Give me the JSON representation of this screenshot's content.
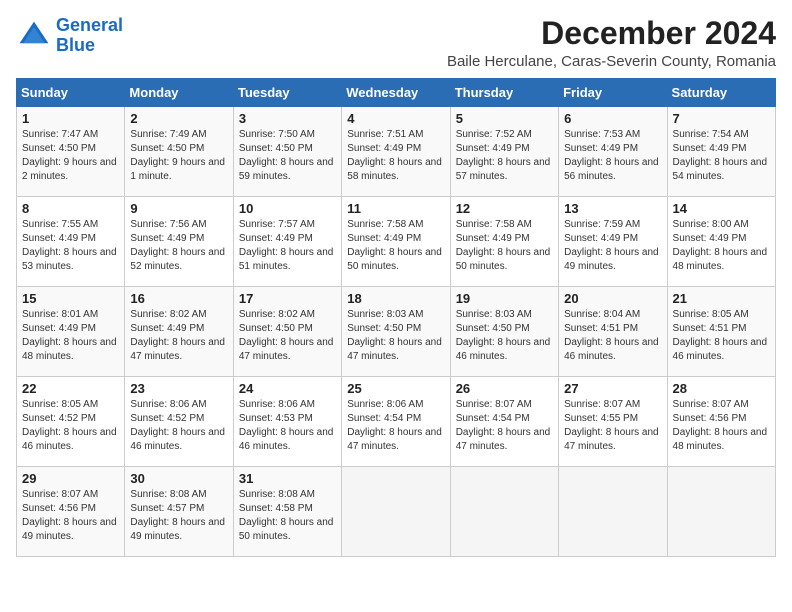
{
  "logo": {
    "line1": "General",
    "line2": "Blue"
  },
  "title": "December 2024",
  "subtitle": "Baile Herculane, Caras-Severin County, Romania",
  "weekdays": [
    "Sunday",
    "Monday",
    "Tuesday",
    "Wednesday",
    "Thursday",
    "Friday",
    "Saturday"
  ],
  "weeks": [
    [
      {
        "day": 1,
        "sunrise": "7:47 AM",
        "sunset": "4:50 PM",
        "daylight": "9 hours and 2 minutes."
      },
      {
        "day": 2,
        "sunrise": "7:49 AM",
        "sunset": "4:50 PM",
        "daylight": "9 hours and 1 minute."
      },
      {
        "day": 3,
        "sunrise": "7:50 AM",
        "sunset": "4:50 PM",
        "daylight": "8 hours and 59 minutes."
      },
      {
        "day": 4,
        "sunrise": "7:51 AM",
        "sunset": "4:49 PM",
        "daylight": "8 hours and 58 minutes."
      },
      {
        "day": 5,
        "sunrise": "7:52 AM",
        "sunset": "4:49 PM",
        "daylight": "8 hours and 57 minutes."
      },
      {
        "day": 6,
        "sunrise": "7:53 AM",
        "sunset": "4:49 PM",
        "daylight": "8 hours and 56 minutes."
      },
      {
        "day": 7,
        "sunrise": "7:54 AM",
        "sunset": "4:49 PM",
        "daylight": "8 hours and 54 minutes."
      }
    ],
    [
      {
        "day": 8,
        "sunrise": "7:55 AM",
        "sunset": "4:49 PM",
        "daylight": "8 hours and 53 minutes."
      },
      {
        "day": 9,
        "sunrise": "7:56 AM",
        "sunset": "4:49 PM",
        "daylight": "8 hours and 52 minutes."
      },
      {
        "day": 10,
        "sunrise": "7:57 AM",
        "sunset": "4:49 PM",
        "daylight": "8 hours and 51 minutes."
      },
      {
        "day": 11,
        "sunrise": "7:58 AM",
        "sunset": "4:49 PM",
        "daylight": "8 hours and 50 minutes."
      },
      {
        "day": 12,
        "sunrise": "7:58 AM",
        "sunset": "4:49 PM",
        "daylight": "8 hours and 50 minutes."
      },
      {
        "day": 13,
        "sunrise": "7:59 AM",
        "sunset": "4:49 PM",
        "daylight": "8 hours and 49 minutes."
      },
      {
        "day": 14,
        "sunrise": "8:00 AM",
        "sunset": "4:49 PM",
        "daylight": "8 hours and 48 minutes."
      }
    ],
    [
      {
        "day": 15,
        "sunrise": "8:01 AM",
        "sunset": "4:49 PM",
        "daylight": "8 hours and 48 minutes."
      },
      {
        "day": 16,
        "sunrise": "8:02 AM",
        "sunset": "4:49 PM",
        "daylight": "8 hours and 47 minutes."
      },
      {
        "day": 17,
        "sunrise": "8:02 AM",
        "sunset": "4:50 PM",
        "daylight": "8 hours and 47 minutes."
      },
      {
        "day": 18,
        "sunrise": "8:03 AM",
        "sunset": "4:50 PM",
        "daylight": "8 hours and 47 minutes."
      },
      {
        "day": 19,
        "sunrise": "8:03 AM",
        "sunset": "4:50 PM",
        "daylight": "8 hours and 46 minutes."
      },
      {
        "day": 20,
        "sunrise": "8:04 AM",
        "sunset": "4:51 PM",
        "daylight": "8 hours and 46 minutes."
      },
      {
        "day": 21,
        "sunrise": "8:05 AM",
        "sunset": "4:51 PM",
        "daylight": "8 hours and 46 minutes."
      }
    ],
    [
      {
        "day": 22,
        "sunrise": "8:05 AM",
        "sunset": "4:52 PM",
        "daylight": "8 hours and 46 minutes."
      },
      {
        "day": 23,
        "sunrise": "8:06 AM",
        "sunset": "4:52 PM",
        "daylight": "8 hours and 46 minutes."
      },
      {
        "day": 24,
        "sunrise": "8:06 AM",
        "sunset": "4:53 PM",
        "daylight": "8 hours and 46 minutes."
      },
      {
        "day": 25,
        "sunrise": "8:06 AM",
        "sunset": "4:54 PM",
        "daylight": "8 hours and 47 minutes."
      },
      {
        "day": 26,
        "sunrise": "8:07 AM",
        "sunset": "4:54 PM",
        "daylight": "8 hours and 47 minutes."
      },
      {
        "day": 27,
        "sunrise": "8:07 AM",
        "sunset": "4:55 PM",
        "daylight": "8 hours and 47 minutes."
      },
      {
        "day": 28,
        "sunrise": "8:07 AM",
        "sunset": "4:56 PM",
        "daylight": "8 hours and 48 minutes."
      }
    ],
    [
      {
        "day": 29,
        "sunrise": "8:07 AM",
        "sunset": "4:56 PM",
        "daylight": "8 hours and 49 minutes."
      },
      {
        "day": 30,
        "sunrise": "8:08 AM",
        "sunset": "4:57 PM",
        "daylight": "8 hours and 49 minutes."
      },
      {
        "day": 31,
        "sunrise": "8:08 AM",
        "sunset": "4:58 PM",
        "daylight": "8 hours and 50 minutes."
      },
      null,
      null,
      null,
      null
    ]
  ]
}
